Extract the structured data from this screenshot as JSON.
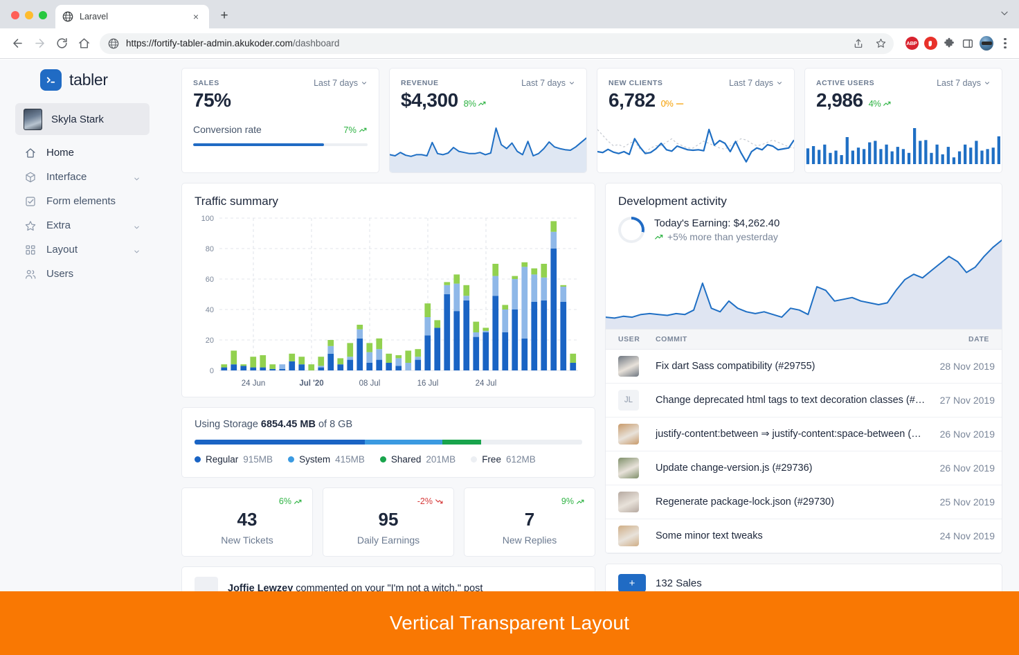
{
  "browser": {
    "tab": {
      "title": "Laravel",
      "favicon": "globe-icon",
      "close": "×"
    },
    "new_tab": "+",
    "url_host": "https://fortify-tabler-admin.akukoder.com",
    "url_path": "/dashboard",
    "extensions": [
      "abp-icon",
      "stop-hand-icon",
      "puzzle-icon",
      "side-panel-icon",
      "profile-avatar",
      "kebab-menu-icon"
    ],
    "abp_label": "ABP"
  },
  "sidebar": {
    "brand": "tabler",
    "user": "Skyla Stark",
    "items": [
      {
        "label": "Home",
        "icon": "home-icon",
        "chevron": false
      },
      {
        "label": "Interface",
        "icon": "package-icon",
        "chevron": true
      },
      {
        "label": "Form elements",
        "icon": "checkbox-icon",
        "chevron": false
      },
      {
        "label": "Extra",
        "icon": "star-icon",
        "chevron": true
      },
      {
        "label": "Layout",
        "icon": "layout-grid-icon",
        "chevron": true
      },
      {
        "label": "Users",
        "icon": "users-icon",
        "chevron": false
      }
    ]
  },
  "stat_cards": [
    {
      "label": "SALES",
      "value": "75%",
      "range": "Last 7 days",
      "sub_label": "Conversion rate",
      "sub_delta": "7%",
      "sub_delta_dir": "up",
      "progress_pct": 75
    },
    {
      "label": "REVENUE",
      "value": "$4,300",
      "delta": "8%",
      "delta_dir": "up",
      "range": "Last 7 days"
    },
    {
      "label": "NEW CLIENTS",
      "value": "6,782",
      "delta": "0%",
      "delta_dir": "flat",
      "range": "Last 7 days"
    },
    {
      "label": "ACTIVE USERS",
      "value": "2,986",
      "delta": "4%",
      "delta_dir": "up",
      "range": "Last 7 days"
    }
  ],
  "traffic": {
    "title": "Traffic summary"
  },
  "storage": {
    "prefix": "Using Storage",
    "used": "6854.45 MB",
    "suffix": "of 8 GB",
    "legend": [
      {
        "name": "Regular",
        "value": "915MB",
        "color": "#1a64c4",
        "pct": 44
      },
      {
        "name": "System",
        "value": "415MB",
        "color": "#3b9ae1",
        "pct": 20
      },
      {
        "name": "Shared",
        "value": "201MB",
        "color": "#19a44c",
        "pct": 10
      },
      {
        "name": "Free",
        "value": "612MB",
        "color": "#eceff3",
        "pct": 26
      }
    ]
  },
  "mini_cards": [
    {
      "delta": "6%",
      "dir": "up",
      "number": "43",
      "title": "New Tickets"
    },
    {
      "delta": "-2%",
      "dir": "down",
      "number": "95",
      "title": "Daily Earnings"
    },
    {
      "delta": "9%",
      "dir": "up",
      "number": "7",
      "title": "New Replies"
    }
  ],
  "dev_activity": {
    "title": "Development activity",
    "earning_line": "Today's Earning: $4,262.40",
    "compare_line": "+5% more than yesterday",
    "donut_pct": 28,
    "columns": [
      "USER",
      "COMMIT",
      "DATE"
    ],
    "rows": [
      {
        "avatar": "photo",
        "avatar_color": "#6e7680",
        "initials": "",
        "commit": "Fix dart Sass compatibility (#29755)",
        "date": "28 Nov 2019"
      },
      {
        "avatar": "initials",
        "avatar_color": "",
        "initials": "JL",
        "commit": "Change deprecated html tags to text decoration classes (#…",
        "date": "27 Nov 2019"
      },
      {
        "avatar": "photo",
        "avatar_color": "#c89a6a",
        "initials": "",
        "commit": "justify-content:between ⇒ justify-content:space-between (…",
        "date": "26 Nov 2019"
      },
      {
        "avatar": "photo",
        "avatar_color": "#7f8f6a",
        "initials": "",
        "commit": "Update change-version.js (#29736)",
        "date": "26 Nov 2019"
      },
      {
        "avatar": "photo",
        "avatar_color": "#b6a9a0",
        "initials": "",
        "commit": "Regenerate package-lock.json (#29730)",
        "date": "25 Nov 2019"
      },
      {
        "avatar": "photo",
        "avatar_color": "#cfae86",
        "initials": "",
        "commit": "Some minor text tweaks",
        "date": "24 Nov 2019"
      }
    ]
  },
  "bottom": {
    "activity_name": "Joffie Lewzey",
    "activity_text": " commented on your \"I'm not a witch.\" post",
    "sales_badge": "+",
    "sales_text": "132 Sales"
  },
  "banner": {
    "text": "Vertical Transparent Layout",
    "color": "#f97803"
  },
  "colors": {
    "accent": "#206bc4",
    "green": "#2fb344",
    "orange": "#f59f00",
    "red": "#d63939",
    "page_bg": "#f7f8fa"
  },
  "chart_data": [
    {
      "type": "bar",
      "name": "traffic-summary",
      "title": "Traffic summary",
      "xlabel": "",
      "ylabel": "",
      "ylim": [
        0,
        100
      ],
      "yticks": [
        0,
        20,
        40,
        60,
        80,
        100
      ],
      "grid": true,
      "legend": "none",
      "tick_labels": [
        "24 Jun",
        "Jul '20",
        "08 Jul",
        "16 Jul",
        "24 Jul"
      ],
      "tick_positions": [
        3,
        9,
        15,
        21,
        27
      ],
      "stacked": true,
      "series": [
        {
          "name": "dark-blue",
          "color": "#1a64c4",
          "values": [
            2,
            4,
            3,
            2,
            2,
            1,
            1,
            6,
            4,
            0,
            2,
            11,
            4,
            7,
            21,
            5,
            7,
            5,
            3,
            0,
            7,
            23,
            28,
            50,
            39,
            46,
            22,
            25,
            49,
            25,
            40,
            21,
            45,
            46,
            80,
            45,
            5
          ]
        },
        {
          "name": "light-blue",
          "color": "#8fb8e8",
          "values": [
            0,
            0,
            0,
            0,
            0,
            0,
            3,
            0,
            0,
            0,
            1,
            5,
            0,
            2,
            6,
            7,
            7,
            0,
            5,
            5,
            2,
            12,
            0,
            6,
            18,
            3,
            3,
            1,
            13,
            15,
            20,
            47,
            18,
            15,
            11,
            10,
            0
          ]
        },
        {
          "name": "green",
          "color": "#92d14f",
          "values": [
            2,
            9,
            1,
            7,
            8,
            3,
            0,
            5,
            5,
            4,
            6,
            4,
            4,
            9,
            3,
            6,
            7,
            6,
            2,
            8,
            5,
            9,
            5,
            2,
            6,
            7,
            7,
            2,
            8,
            3,
            2,
            3,
            4,
            9,
            7,
            1,
            6
          ]
        }
      ]
    },
    {
      "type": "area",
      "name": "revenue-sparkline",
      "color": "#1f6fc4",
      "fill": "#dfe7f3",
      "values": [
        22,
        20,
        26,
        21,
        19,
        22,
        22,
        20,
        44,
        24,
        22,
        25,
        35,
        28,
        26,
        24,
        24,
        26,
        22,
        25,
        70,
        40,
        33,
        43,
        28,
        22,
        46,
        20,
        24,
        33,
        45,
        36,
        33,
        31,
        30,
        36,
        44,
        52
      ]
    },
    {
      "type": "line",
      "name": "new-clients-sparkline",
      "color": "#1f6fc4",
      "values": [
        30,
        28,
        35,
        29,
        26,
        30,
        24,
        58,
        40,
        26,
        28,
        36,
        48,
        34,
        31,
        42,
        38,
        34,
        33,
        34,
        32,
        78,
        44,
        54,
        48,
        30,
        52,
        28,
        8,
        30,
        38,
        34,
        45,
        42,
        34,
        36,
        38,
        55
      ],
      "comparison_color": "#c5c9d0",
      "comparison_values": [
        62,
        52,
        42,
        34,
        36,
        32,
        38,
        42,
        28,
        22,
        30,
        34,
        34,
        40,
        46,
        38,
        34,
        30,
        30,
        36,
        42,
        38,
        34,
        30,
        28,
        34,
        40,
        46,
        44,
        38,
        34,
        36,
        40,
        44,
        40,
        36,
        32,
        30
      ]
    },
    {
      "type": "bar",
      "name": "active-users-bars",
      "color": "#1f6fc4",
      "values": [
        42,
        48,
        38,
        52,
        30,
        36,
        24,
        72,
        36,
        44,
        40,
        58,
        62,
        40,
        52,
        34,
        46,
        40,
        30,
        96,
        62,
        64,
        30,
        52,
        26,
        46,
        18,
        34,
        52,
        44,
        62,
        36,
        40,
        44,
        74
      ]
    },
    {
      "type": "area",
      "name": "development-activity-chart",
      "color": "#1f6fc4",
      "fill": "#dfe5f2",
      "values": [
        10,
        9,
        11,
        10,
        13,
        14,
        13,
        12,
        14,
        13,
        18,
        48,
        20,
        16,
        28,
        20,
        16,
        14,
        16,
        13,
        10,
        20,
        18,
        13,
        44,
        40,
        28,
        30,
        32,
        28,
        26,
        24,
        26,
        40,
        52,
        58,
        54,
        62,
        70,
        78,
        72,
        60,
        66,
        78,
        88,
        96
      ]
    }
  ]
}
